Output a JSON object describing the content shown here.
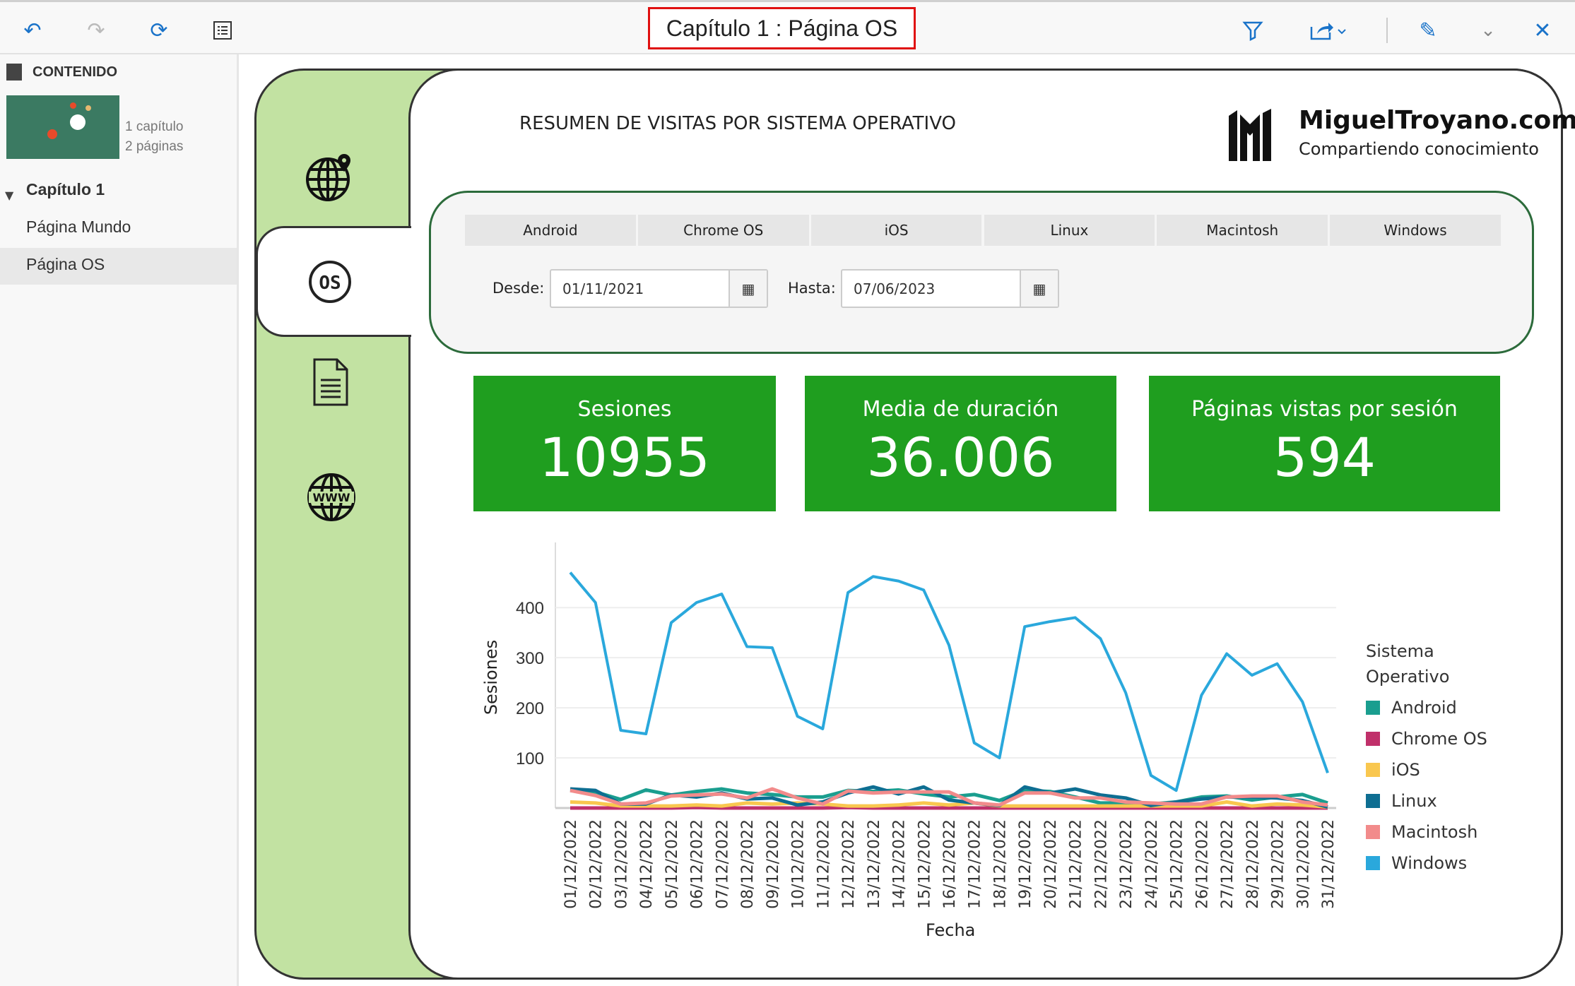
{
  "toolbar": {
    "title": "Capítulo 1 : Página OS",
    "icons": [
      "undo-icon",
      "redo-icon",
      "refresh-icon",
      "list-icon",
      "filter-icon",
      "share-icon",
      "pencil-icon",
      "collapse-icon",
      "close-icon"
    ]
  },
  "sidebar": {
    "header": "CONTENIDO",
    "chapters_count": "1 capítulo",
    "pages_count": "2 páginas",
    "chapter": "Capítulo 1",
    "pages": [
      "Página Mundo",
      "Página OS"
    ],
    "selected": "Página OS"
  },
  "report": {
    "title": "RESUMEN DE VISITAS POR SISTEMA OPERATIVO",
    "logo": {
      "name": "MiguelTroyano.com",
      "tagline": "Compartiendo conocimiento"
    },
    "os_tabs": [
      "Android",
      "Chrome OS",
      "iOS",
      "Linux",
      "Macintosh",
      "Windows"
    ],
    "desde_label": "Desde:",
    "desde_value": "01/11/2021",
    "hasta_label": "Hasta:",
    "hasta_value": "07/06/2023",
    "kpis": [
      {
        "title": "Sesiones",
        "value": "10955"
      },
      {
        "title": "Media de duración",
        "value": "36.006"
      },
      {
        "title": "Páginas vistas por sesión",
        "value": "594"
      }
    ],
    "accent": "#1f9e1f",
    "panel_color": "#c2e2a2"
  },
  "chart_data": {
    "type": "line",
    "xlabel": "Fecha",
    "ylabel": "Sesiones",
    "ylim": [
      0,
      530
    ],
    "yticks": [
      100,
      200,
      300,
      400
    ],
    "grid": true,
    "legend": "right",
    "legend_title": "Sistema Operativo",
    "categories": [
      "01/12/2022",
      "02/12/2022",
      "03/12/2022",
      "04/12/2022",
      "05/12/2022",
      "06/12/2022",
      "07/12/2022",
      "08/12/2022",
      "09/12/2022",
      "10/12/2022",
      "11/12/2022",
      "12/12/2022",
      "13/12/2022",
      "14/12/2022",
      "15/12/2022",
      "16/12/2022",
      "17/12/2022",
      "18/12/2022",
      "19/12/2022",
      "20/12/2022",
      "21/12/2022",
      "22/12/2022",
      "23/12/2022",
      "24/12/2022",
      "25/12/2022",
      "26/12/2022",
      "27/12/2022",
      "28/12/2022",
      "29/12/2022",
      "30/12/2022",
      "31/12/2022"
    ],
    "series": [
      {
        "name": "Android",
        "color": "#1a9e8f",
        "values": [
          35,
          32,
          17,
          36,
          26,
          33,
          38,
          30,
          27,
          22,
          22,
          35,
          33,
          36,
          28,
          22,
          27,
          15,
          35,
          33,
          22,
          10,
          10,
          8,
          12,
          22,
          24,
          16,
          22,
          27,
          10
        ]
      },
      {
        "name": "Chrome OS",
        "color": "#c0306a",
        "values": [
          0,
          0,
          0,
          0,
          0,
          1,
          0,
          0,
          0,
          0,
          0,
          1,
          0,
          0,
          0,
          0,
          0,
          0,
          0,
          0,
          0,
          0,
          0,
          0,
          0,
          0,
          0,
          0,
          0,
          0,
          0
        ]
      },
      {
        "name": "iOS",
        "color": "#f9c74f",
        "values": [
          12,
          10,
          4,
          4,
          4,
          6,
          4,
          10,
          8,
          10,
          8,
          4,
          4,
          6,
          10,
          6,
          10,
          4,
          4,
          4,
          4,
          4,
          4,
          4,
          4,
          4,
          12,
          4,
          8,
          6,
          2
        ]
      },
      {
        "name": "Linux",
        "color": "#0e6e92",
        "values": [
          38,
          35,
          8,
          8,
          26,
          22,
          30,
          18,
          20,
          6,
          12,
          30,
          42,
          28,
          42,
          16,
          10,
          5,
          42,
          30,
          38,
          26,
          20,
          5,
          12,
          18,
          22,
          22,
          20,
          15,
          2
        ]
      },
      {
        "name": "Macintosh",
        "color": "#f28b8b",
        "values": [
          35,
          25,
          8,
          10,
          24,
          26,
          28,
          20,
          38,
          20,
          8,
          34,
          30,
          32,
          32,
          32,
          10,
          6,
          30,
          30,
          20,
          20,
          12,
          10,
          8,
          8,
          22,
          24,
          24,
          12,
          6
        ]
      },
      {
        "name": "Windows",
        "color": "#2aa8dc",
        "values": [
          470,
          410,
          155,
          148,
          370,
          410,
          427,
          322,
          320,
          183,
          158,
          430,
          462,
          453,
          435,
          325,
          130,
          100,
          362,
          372,
          380,
          338,
          230,
          65,
          35,
          225,
          308,
          265,
          288,
          212,
          70
        ]
      }
    ]
  }
}
